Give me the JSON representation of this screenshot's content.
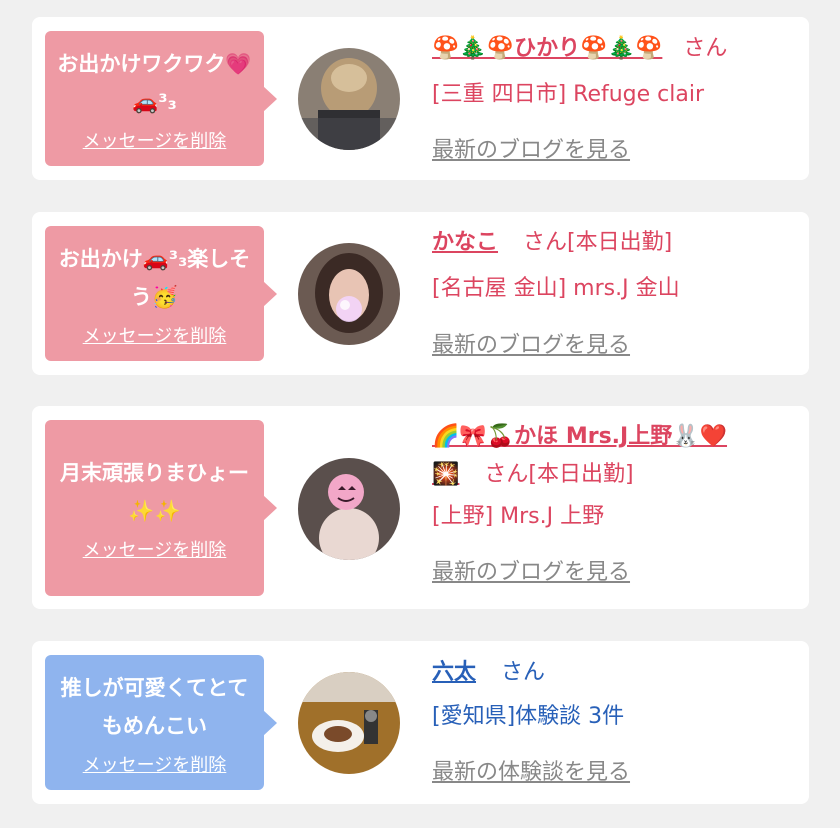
{
  "cards": [
    {
      "message": "お出かけワクワク💗🚗³₃",
      "delete_label": "メッセージを削除",
      "name": "🍄🎄🍄ひかり🍄🎄🍄",
      "san": "さん",
      "shop": "[三重 四日市] Refuge clair",
      "link": "最新のブログを見る"
    },
    {
      "message": "お出かけ🚗³₃楽しそう🥳",
      "delete_label": "メッセージを削除",
      "name": "かなこ",
      "san": "さん[本日出勤]",
      "shop": "[名古屋 金山] mrs.J 金山",
      "link": "最新のブログを見る"
    },
    {
      "message": "月末頑張りまひょー✨✨",
      "delete_label": "メッセージを削除",
      "name": "🌈🎀🍒かほ Mrs.J上野🐰❤️",
      "name_cont": "🎇",
      "san": "さん[本日出勤]",
      "shop": "[上野] Mrs.J 上野",
      "link": "最新のブログを見る"
    },
    {
      "message": "推しが可愛くてとてもめんこい",
      "delete_label": "メッセージを削除",
      "name": "六太",
      "san": "さん",
      "shop": "[愛知県]体験談 3件",
      "link": "最新の体験談を見る"
    }
  ],
  "colors": {
    "bubble_pink": "#ee9aa4",
    "bubble_blue": "#8fb4ee",
    "name_pink": "#dc4560",
    "name_blue": "#2860b8",
    "link_gray": "#888888",
    "background": "#f0f0f0"
  }
}
